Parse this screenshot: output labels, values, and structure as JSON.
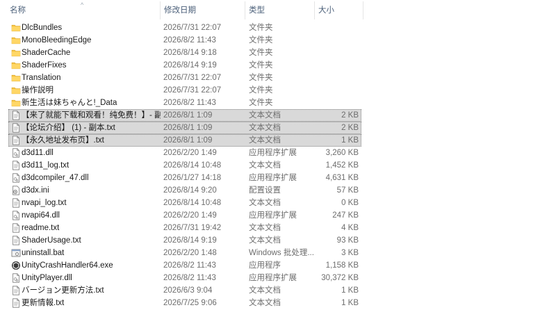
{
  "columns": {
    "name": "名称",
    "modified": "修改日期",
    "type": "类型",
    "size": "大小"
  },
  "sort_indicator": "^",
  "files": [
    {
      "name": "DlcBundles",
      "date": "2026/7/31 22:07",
      "type": "文件夹",
      "size": "",
      "icon": "folder-icon",
      "selected": false
    },
    {
      "name": "MonoBleedingEdge",
      "date": "2026/8/2 11:43",
      "type": "文件夹",
      "size": "",
      "icon": "folder-icon",
      "selected": false
    },
    {
      "name": "ShaderCache",
      "date": "2026/8/14 9:18",
      "type": "文件夹",
      "size": "",
      "icon": "folder-icon",
      "selected": false
    },
    {
      "name": "ShaderFixes",
      "date": "2026/8/14 9:19",
      "type": "文件夹",
      "size": "",
      "icon": "folder-icon",
      "selected": false
    },
    {
      "name": "Translation",
      "date": "2026/7/31 22:07",
      "type": "文件夹",
      "size": "",
      "icon": "folder-icon",
      "selected": false
    },
    {
      "name": "操作説明",
      "date": "2026/7/31 22:07",
      "type": "文件夹",
      "size": "",
      "icon": "folder-icon",
      "selected": false
    },
    {
      "name": "新生活は妹ちゃんと!_Data",
      "date": "2026/8/2 11:43",
      "type": "文件夹",
      "size": "",
      "icon": "folder-icon",
      "selected": false
    },
    {
      "name": "【来了就能下载和观看！纯免费！】- 副...",
      "date": "2026/8/1 1:09",
      "type": "文本文档",
      "size": "2 KB",
      "icon": "text-file-icon",
      "selected": true
    },
    {
      "name": "【论坛介绍】 (1) - 副本.txt",
      "date": "2026/8/1 1:09",
      "type": "文本文档",
      "size": "2 KB",
      "icon": "text-file-icon",
      "selected": true
    },
    {
      "name": "【永久地址发布页】.txt",
      "date": "2026/8/1 1:09",
      "type": "文本文档",
      "size": "1 KB",
      "icon": "text-file-icon",
      "selected": true
    },
    {
      "name": "d3d11.dll",
      "date": "2026/2/20 1:49",
      "type": "应用程序扩展",
      "size": "3,260 KB",
      "icon": "dll-file-icon",
      "selected": false
    },
    {
      "name": "d3d11_log.txt",
      "date": "2026/8/14 10:48",
      "type": "文本文档",
      "size": "1,452 KB",
      "icon": "text-file-icon",
      "selected": false
    },
    {
      "name": "d3dcompiler_47.dll",
      "date": "2026/1/27 14:18",
      "type": "应用程序扩展",
      "size": "4,631 KB",
      "icon": "dll-file-icon",
      "selected": false
    },
    {
      "name": "d3dx.ini",
      "date": "2026/8/14 9:20",
      "type": "配置设置",
      "size": "57 KB",
      "icon": "ini-file-icon",
      "selected": false
    },
    {
      "name": "nvapi_log.txt",
      "date": "2026/8/14 10:48",
      "type": "文本文档",
      "size": "0 KB",
      "icon": "text-file-icon",
      "selected": false
    },
    {
      "name": "nvapi64.dll",
      "date": "2026/2/20 1:49",
      "type": "应用程序扩展",
      "size": "247 KB",
      "icon": "dll-file-icon",
      "selected": false
    },
    {
      "name": "readme.txt",
      "date": "2026/7/31 19:42",
      "type": "文本文档",
      "size": "4 KB",
      "icon": "text-file-icon",
      "selected": false
    },
    {
      "name": "ShaderUsage.txt",
      "date": "2026/8/14 9:19",
      "type": "文本文档",
      "size": "93 KB",
      "icon": "text-file-icon",
      "selected": false
    },
    {
      "name": "uninstall.bat",
      "date": "2026/2/20 1:48",
      "type": "Windows 批处理...",
      "size": "3 KB",
      "icon": "bat-file-icon",
      "selected": false
    },
    {
      "name": "UnityCrashHandler64.exe",
      "date": "2026/8/2 11:43",
      "type": "应用程序",
      "size": "1,158 KB",
      "icon": "unity-exe-icon",
      "selected": false
    },
    {
      "name": "UnityPlayer.dll",
      "date": "2026/8/2 11:43",
      "type": "应用程序扩展",
      "size": "30,372 KB",
      "icon": "dll-file-icon",
      "selected": false
    },
    {
      "name": "バージョン更新方法.txt",
      "date": "2026/6/3 9:04",
      "type": "文本文档",
      "size": "1 KB",
      "icon": "text-file-icon",
      "selected": false
    },
    {
      "name": "更新情報.txt",
      "date": "2026/7/25 9:06",
      "type": "文本文档",
      "size": "1 KB",
      "icon": "text-file-icon",
      "selected": false
    }
  ],
  "colors": {
    "header_text": "#4c607a",
    "selection": "#d9d9d9",
    "folder": "#f5c342",
    "meta_text": "#6d6d6d"
  }
}
